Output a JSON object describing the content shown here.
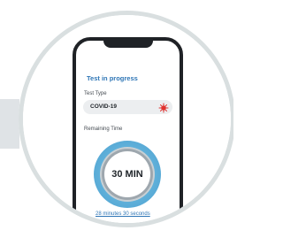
{
  "screen": {
    "title": "Test in progress",
    "test_type_label": "Test Type",
    "test_type_value": "COVID-19",
    "remaining_label": "Remaining Time",
    "timer_text": "30 MIN",
    "countdown_text": "28 minutes  30 seconds"
  },
  "icons": {
    "virus": "virus-icon"
  },
  "colors": {
    "accent": "#2f76b6",
    "timer_ring": "#5eafd9",
    "virus": "#e0322f"
  }
}
